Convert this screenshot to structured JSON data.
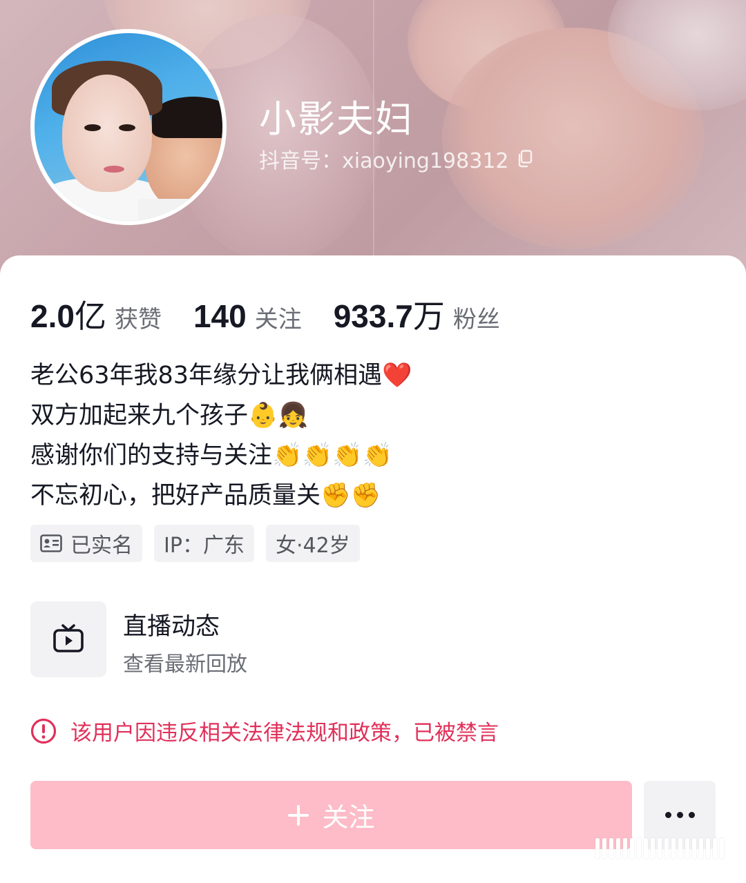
{
  "profile": {
    "nickname": "小影夫妇",
    "douyin_id": "抖音号：xiaoying198312",
    "avatar_alt": "avatar"
  },
  "stats": [
    {
      "value": "2.0",
      "unit": "亿",
      "label": "获赞"
    },
    {
      "value": "140",
      "unit": "",
      "label": "关注"
    },
    {
      "value": "933.7",
      "unit": "万",
      "label": "粉丝"
    }
  ],
  "bio": {
    "lines": [
      "老公63年我83年缘分让我俩相遇❤️",
      "双方加起来九个孩子👶👧",
      "感谢你们的支持与关注👏👏👏👏",
      "不忘初心，把好产品质量关✊✊"
    ]
  },
  "tags": {
    "verified": "已实名",
    "ip": "IP：广东",
    "gender_age": "女·42岁"
  },
  "live": {
    "title": "直播动态",
    "subtitle": "查看最新回放"
  },
  "warning": {
    "text": "该用户因违反相关法律法规和政策，已被禁言"
  },
  "actions": {
    "follow_label": "关注"
  },
  "colors": {
    "warning": "#e0305a",
    "follow_button": "#fdbcc7",
    "text_primary": "#161823",
    "text_secondary": "#6b6d75"
  },
  "icons": [
    "copy-icon",
    "id-card-icon",
    "tv-icon",
    "warning-icon",
    "plus-icon",
    "more-icon"
  ]
}
